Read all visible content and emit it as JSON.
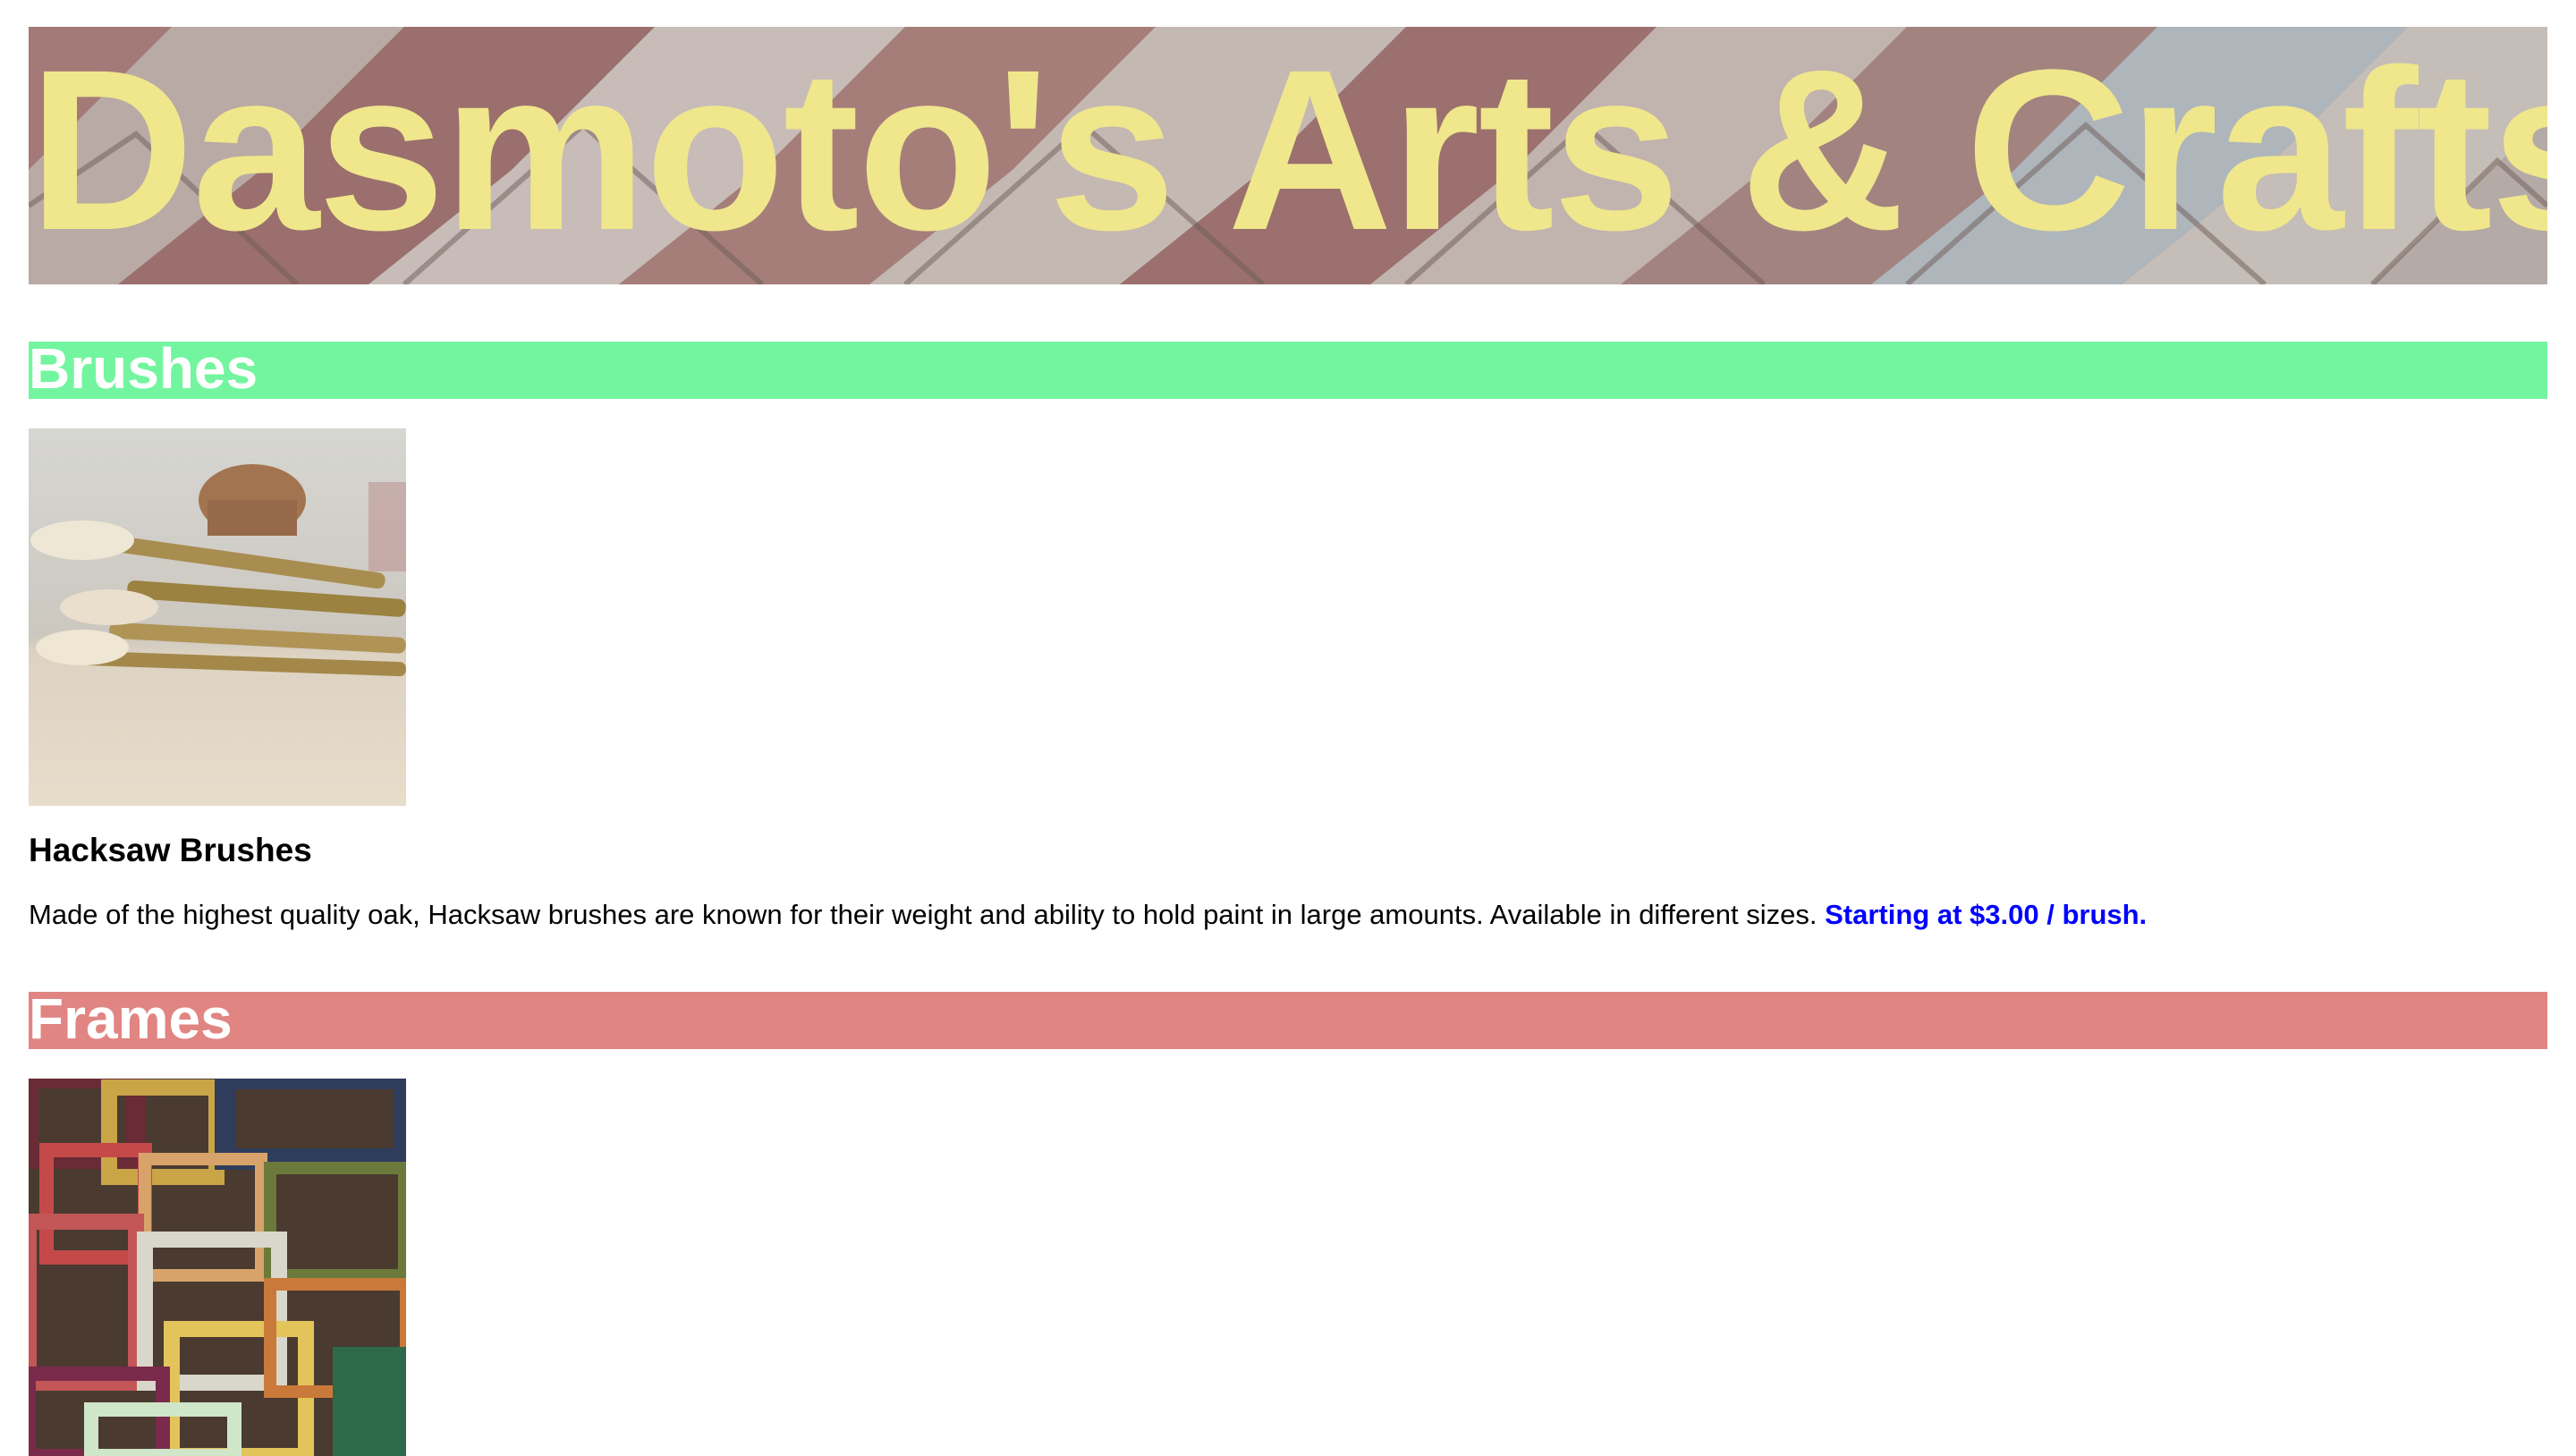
{
  "banner": {
    "title": "Dasmoto's Arts & Crafts"
  },
  "sections": [
    {
      "heading": "Brushes",
      "heading_color": "#73f5a0",
      "image_alt": "brush-photo",
      "product_name": "Hacksaw Brushes",
      "description": "Made of the highest quality oak, Hacksaw brushes are known for their weight and ability to hold paint in large amounts. Available in different sizes.",
      "price": "Starting at $3.00 / brush."
    },
    {
      "heading": "Frames",
      "heading_color": "#e08582",
      "image_alt": "frames-photo"
    }
  ],
  "colors": {
    "banner_text": "#f0e68c",
    "price_text": "#0000ff",
    "heading_text": "#ffffff"
  }
}
